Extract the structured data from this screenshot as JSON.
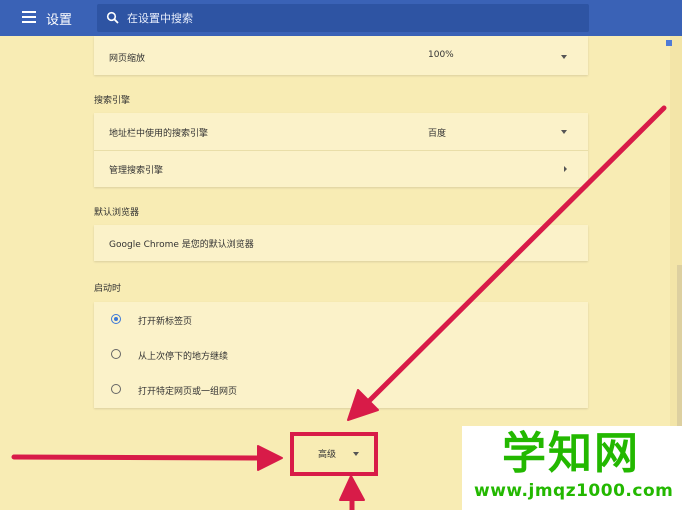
{
  "header": {
    "title": "设置",
    "search_placeholder": "在设置中搜索"
  },
  "sections": {
    "page_zoom": {
      "label": "网页缩放",
      "value": "100%"
    },
    "search_engine": {
      "title": "搜索引擎",
      "address_bar_label": "地址栏中使用的搜索引擎",
      "address_bar_value": "百度",
      "manage_label": "管理搜索引擎"
    },
    "default_browser": {
      "title": "默认浏览器",
      "text": "Google Chrome 是您的默认浏览器"
    },
    "startup": {
      "title": "启动时",
      "options": [
        {
          "label": "打开新标签页",
          "selected": true
        },
        {
          "label": "从上次停下的地方继续",
          "selected": false
        },
        {
          "label": "打开特定网页或一组网页",
          "selected": false
        }
      ]
    }
  },
  "advanced": {
    "label": "高级"
  },
  "watermark": {
    "main": "学知网",
    "sub": "www.jmqz1000.com"
  },
  "colors": {
    "header": "#3a62b6",
    "background": "#f8ecb4",
    "highlight": "#d81b48",
    "watermark": "#23b800",
    "radio_accent": "#3b78d8"
  }
}
